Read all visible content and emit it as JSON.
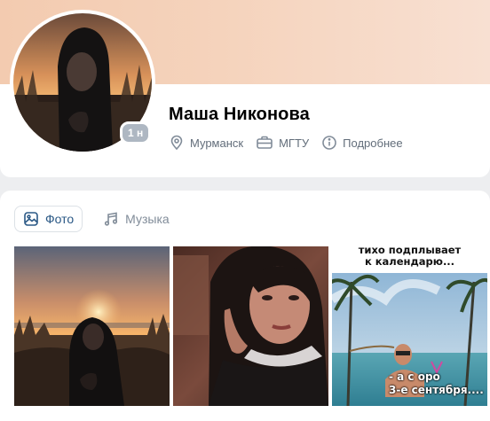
{
  "profile": {
    "name": "Маша Никонова",
    "online_badge": "1 н",
    "city": "Мурманск",
    "university": "МГТУ",
    "details_label": "Подробнее",
    "cover_color": "#f5d3bc"
  },
  "tabs": [
    {
      "label": "Фото",
      "icon": "photo-icon",
      "active": true
    },
    {
      "label": "Музыка",
      "icon": "music-note-icon",
      "active": false
    }
  ],
  "photos": [
    {
      "kind": "sunset-portrait"
    },
    {
      "kind": "selfie"
    },
    {
      "kind": "meme",
      "top_text_line1": "тихо подплывает",
      "top_text_line2": "к календарю...",
      "caption_line1": "- а с   оро",
      "caption_line2": "3-е сентября...."
    }
  ],
  "colors": {
    "link": "#2a5885",
    "secondary_text": "#626d7a",
    "badge": "#aeb7c2"
  }
}
